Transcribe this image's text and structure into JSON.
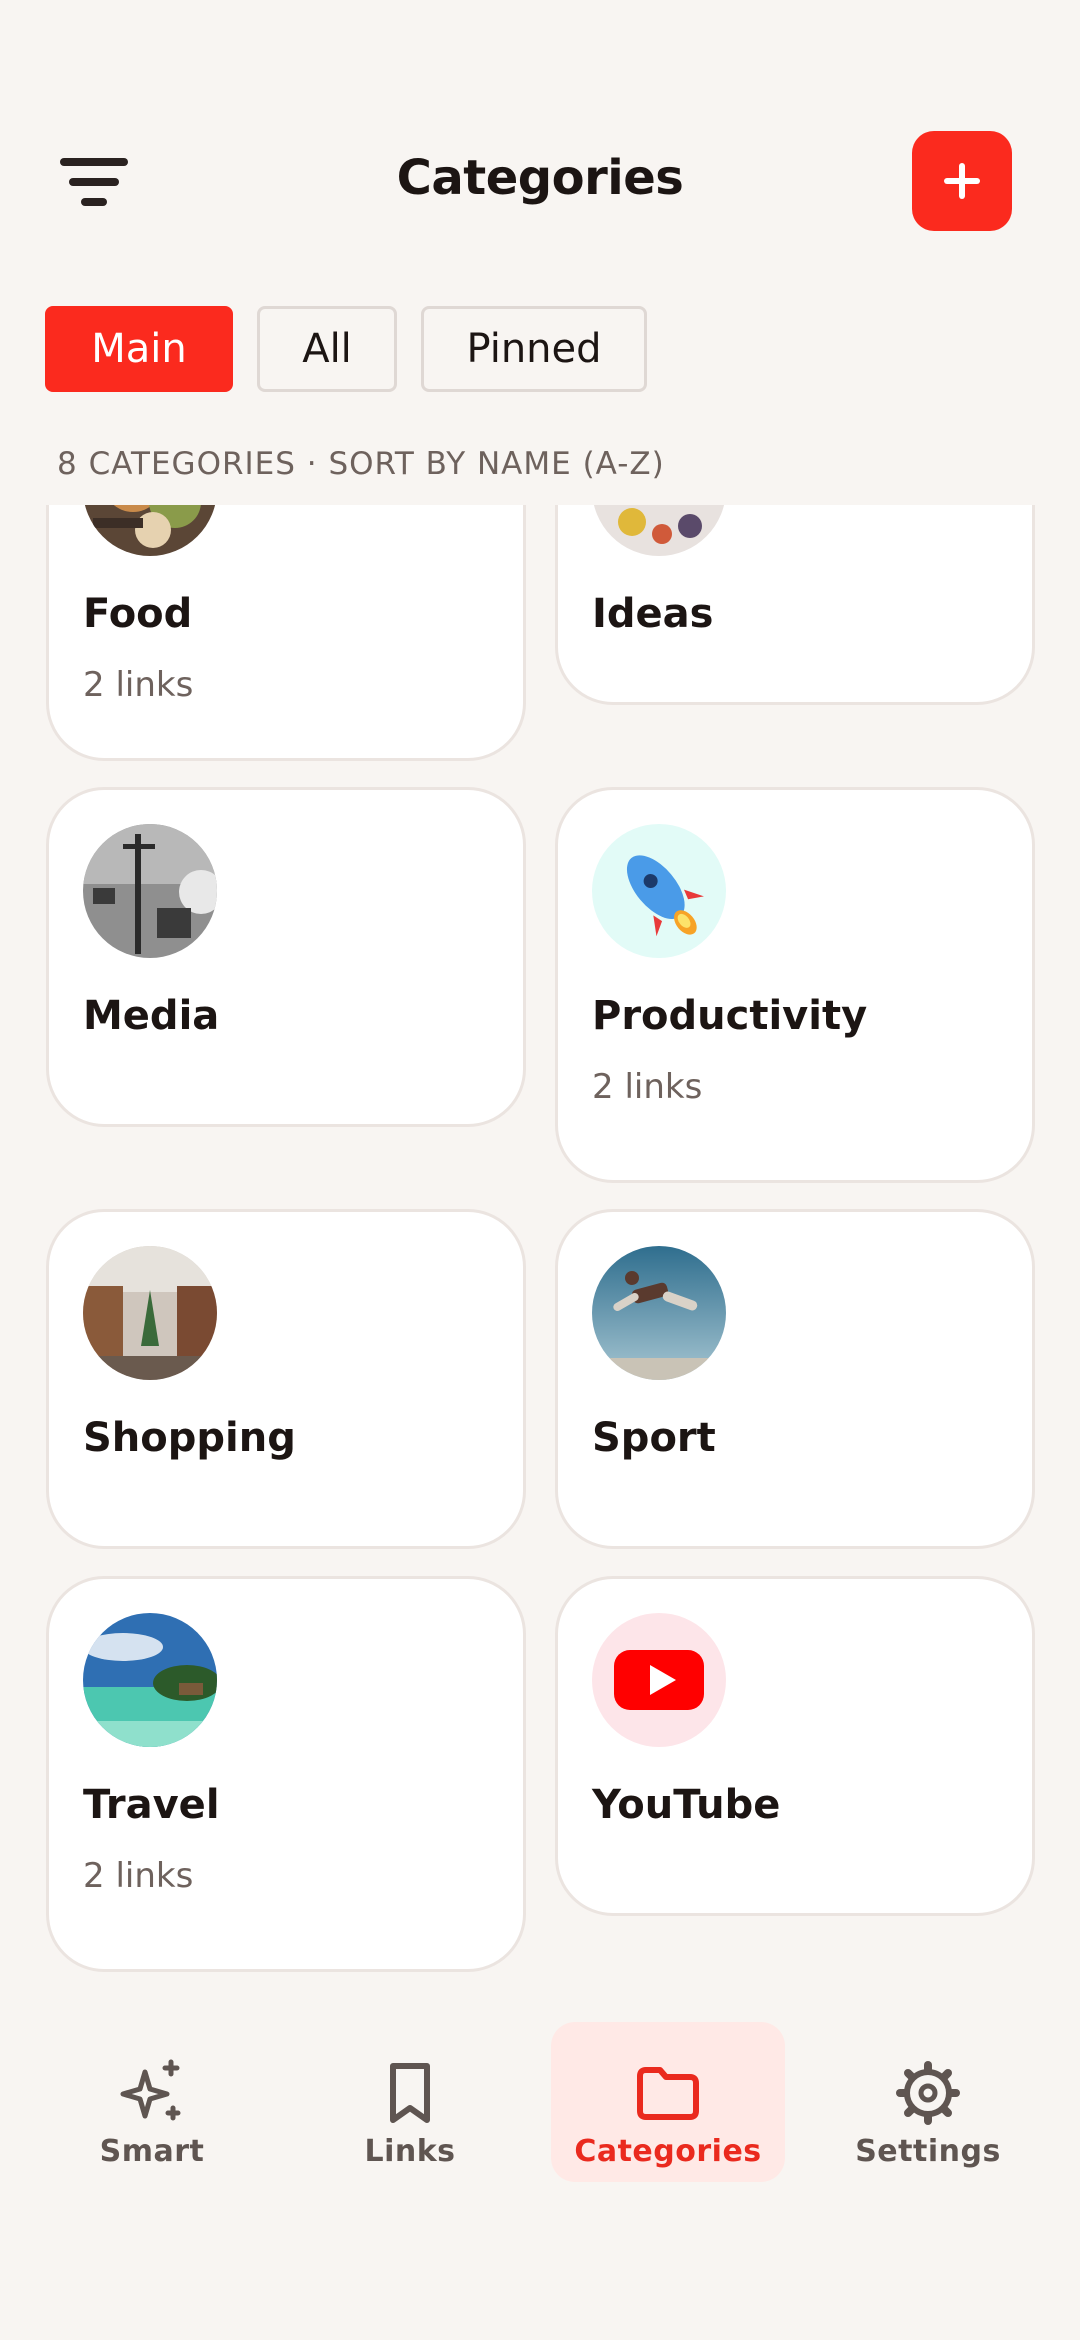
{
  "header": {
    "title": "Categories",
    "menu_icon": "filter-menu-icon",
    "add_icon": "plus-icon",
    "accent": "#fb2a1e"
  },
  "filters": {
    "main": "Main",
    "all": "All",
    "pinned": "Pinned",
    "active": "Main"
  },
  "summary": "8 CATEGORIES · SORT BY NAME (A-Z)",
  "categories": [
    {
      "name": "Food",
      "count": "2 links",
      "image": "food-photo"
    },
    {
      "name": "Ideas",
      "count": "",
      "image": "ideas-photo"
    },
    {
      "name": "Media",
      "count": "",
      "image": "media-studio-photo"
    },
    {
      "name": "Productivity",
      "count": "2 links",
      "image": "rocket-emoji"
    },
    {
      "name": "Shopping",
      "count": "",
      "image": "shopping-arcade-photo"
    },
    {
      "name": "Sport",
      "count": "",
      "image": "sport-jump-photo"
    },
    {
      "name": "Travel",
      "count": "2 links",
      "image": "beach-photo"
    },
    {
      "name": "YouTube",
      "count": "",
      "image": "youtube-logo"
    }
  ],
  "nav": [
    {
      "label": "Smart",
      "icon": "sparkles-icon"
    },
    {
      "label": "Links",
      "icon": "bookmark-icon"
    },
    {
      "label": "Categories",
      "icon": "folder-icon",
      "active": true
    },
    {
      "label": "Settings",
      "icon": "gear-icon"
    }
  ]
}
